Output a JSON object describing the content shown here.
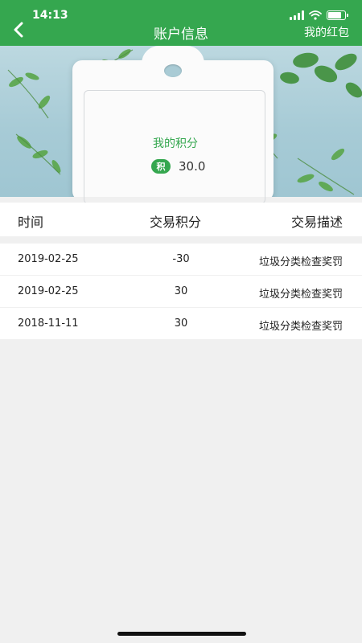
{
  "status_bar": {
    "time": "14:13"
  },
  "nav": {
    "title": "账户信息",
    "right_link": "我的红包"
  },
  "points": {
    "label": "我的积分",
    "badge": "积",
    "value": "30.0"
  },
  "table": {
    "headers": [
      "时间",
      "交易积分",
      "交易描述"
    ],
    "rows": [
      {
        "date": "2019-02-25",
        "points": "-30",
        "desc": "垃圾分类检查奖罚"
      },
      {
        "date": "2019-02-25",
        "points": "30",
        "desc": "垃圾分类检查奖罚"
      },
      {
        "date": "2018-11-11",
        "points": "30",
        "desc": "垃圾分类检查奖罚"
      }
    ]
  },
  "colors": {
    "brand_green": "#35a74f",
    "background": "#f0f0f0"
  }
}
